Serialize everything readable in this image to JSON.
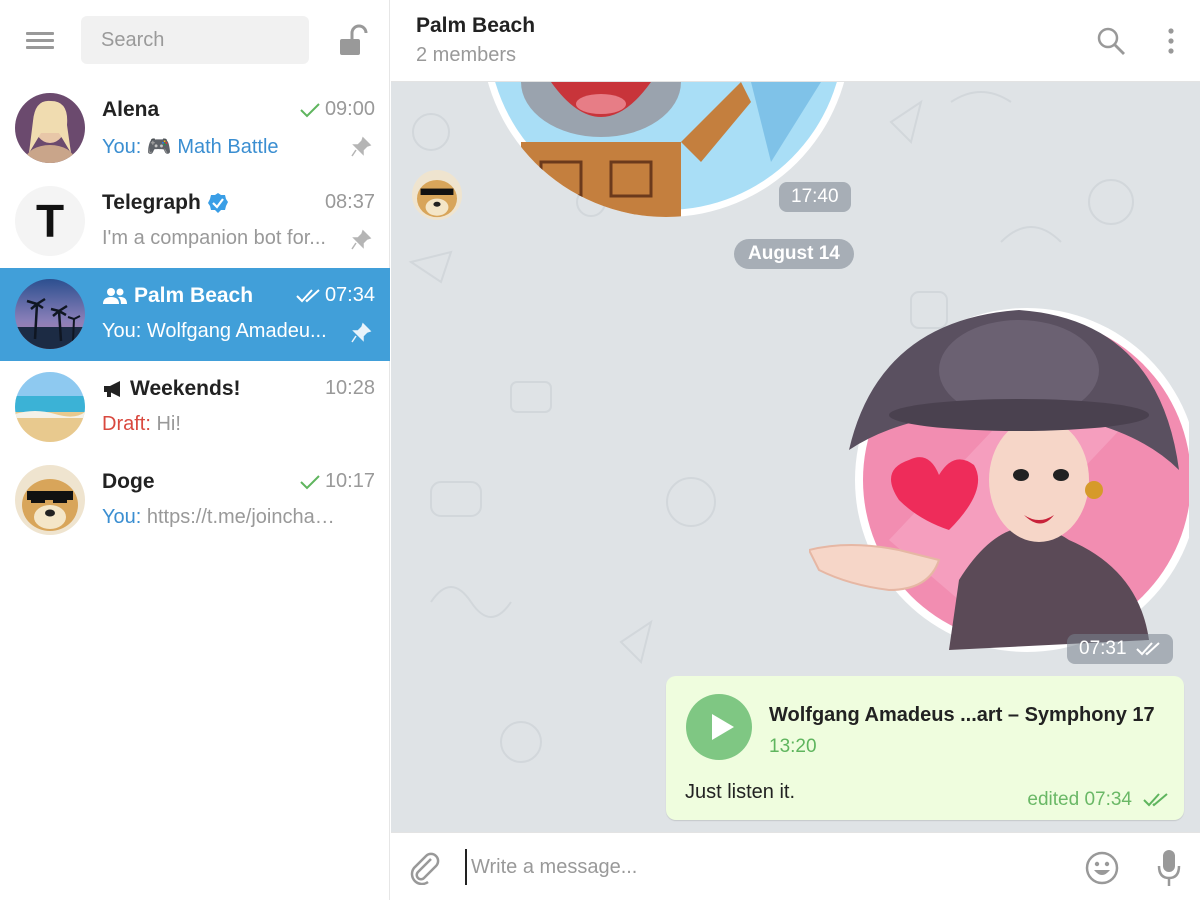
{
  "sidebar": {
    "search_placeholder": "Search",
    "chats": [
      {
        "name": "Alena",
        "time": "09:00",
        "status": "sent",
        "you": "You:",
        "preview_emoji": "🎮",
        "preview": "Math Battle",
        "pinned": true,
        "active": false
      },
      {
        "name": "Telegraph",
        "verified": true,
        "time": "08:37",
        "preview": "I'm a companion bot for...",
        "avatar_letter": "T",
        "pinned": true,
        "active": false
      },
      {
        "name": "Palm Beach",
        "group": true,
        "time": "07:34",
        "status": "read",
        "you": "You:",
        "preview": "Wolfgang Amadeu...",
        "pinned": true,
        "active": true
      },
      {
        "name": "Weekends!",
        "channel": true,
        "time": "10:28",
        "draft_label": "Draft:",
        "preview": "Hi!",
        "pinned": false,
        "active": false
      },
      {
        "name": "Doge",
        "time": "10:17",
        "status": "sent",
        "you": "You:",
        "preview": "https://t.me/joinchat/G...",
        "pinned": false,
        "active": false
      }
    ]
  },
  "header": {
    "title": "Palm Beach",
    "subtitle": "2 members"
  },
  "messages": {
    "sticker1_time": "17:40",
    "date_divider": "August 14",
    "sticker2_time": "07:31",
    "audio": {
      "title": "Wolfgang Amadeus ...art – Symphony 17",
      "duration": "13:20",
      "caption": "Just listen it.",
      "meta": "edited 07:34"
    }
  },
  "compose": {
    "placeholder": "Write a message..."
  },
  "colors": {
    "accent": "#419fd9",
    "link": "#3a8ed1",
    "draft": "#d9493f",
    "check": "#5fb55e",
    "bubble_out": "#effdde",
    "chat_bg": "#dfe3e6"
  }
}
